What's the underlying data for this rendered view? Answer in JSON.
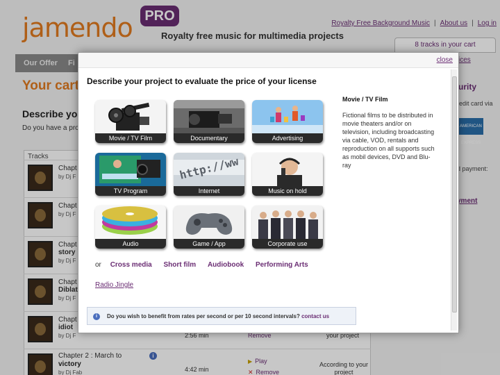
{
  "header": {
    "logo_text": "jamendo",
    "pro_badge": "PRO",
    "tagline": "Royalty free music for multimedia projects",
    "top_links": [
      "Royalty Free Background Music",
      "About us",
      "Log in"
    ]
  },
  "nav": {
    "items": [
      "Our Offer",
      "Fi"
    ]
  },
  "cart_box": {
    "label": "8 tracks in your cart"
  },
  "background": {
    "heading": "Your cart",
    "describe": "Describe yo",
    "have_project": "Do you have a pro",
    "tracks_header": "Tracks",
    "tracks": [
      {
        "title": "Chapt",
        "artist": "by Dj F"
      },
      {
        "title": "Chapt",
        "artist": "by Dj F"
      },
      {
        "title": "Chapt",
        "title2": "story",
        "artist": "by Dj F"
      },
      {
        "title": "Chapt",
        "title2": "Diblat",
        "artist": "by Dj F"
      },
      {
        "title": "Chapt",
        "title2": "idiot",
        "artist": "by Dj F"
      }
    ],
    "last_track": {
      "title": "Chapter 2 : March to",
      "title2": "victory",
      "artist": "by Dj Fab",
      "duration": "4:42 min",
      "play": "Play",
      "remove": "Remove",
      "price": "According to your project"
    },
    "prev_row": {
      "duration": "2:56 min",
      "remove": "Remove",
      "price": "your project"
    },
    "right": {
      "ices": "ices",
      "security": "urity",
      "card": "redit card via",
      "amex": "AMERICAN EXPRESS",
      "payment": "d payment:",
      "ment": "yment"
    }
  },
  "modal": {
    "close": "close",
    "title": "Describe your project to evaluate the price of your license",
    "tiles": [
      {
        "label": "Movie / TV Film",
        "icon": "film-camera-icon"
      },
      {
        "label": "Documentary",
        "icon": "pro-camera-icon"
      },
      {
        "label": "Advertising",
        "icon": "shopping-people-icon"
      },
      {
        "label": "TV Program",
        "icon": "tv-broadcast-icon"
      },
      {
        "label": "Internet",
        "icon": "http-address-icon"
      },
      {
        "label": "Music on hold",
        "icon": "phone-operator-icon"
      },
      {
        "label": "Audio",
        "icon": "cd-stack-icon"
      },
      {
        "label": "Game / App",
        "icon": "gamepad-icon"
      },
      {
        "label": "Corporate use",
        "icon": "business-team-icon"
      }
    ],
    "or_label": "or",
    "more_links": [
      "Cross media",
      "Short film",
      "Audiobook",
      "Performing Arts"
    ],
    "radio_link": "Radio Jingle",
    "note": "Do you wish to benefit from rates per second or per 10 second intervals?",
    "note_link": "contact us",
    "desc_title": "Movie / TV Film",
    "desc_text": "Fictional films to be distributed in movie theaters and/or on television, including broadcasting via cable, VOD, rentals and reproduction on all supports such as mobil devices, DVD and Blu-ray"
  },
  "colors": {
    "brand_orange": "#e07a1f",
    "brand_purple": "#6a2d73"
  }
}
